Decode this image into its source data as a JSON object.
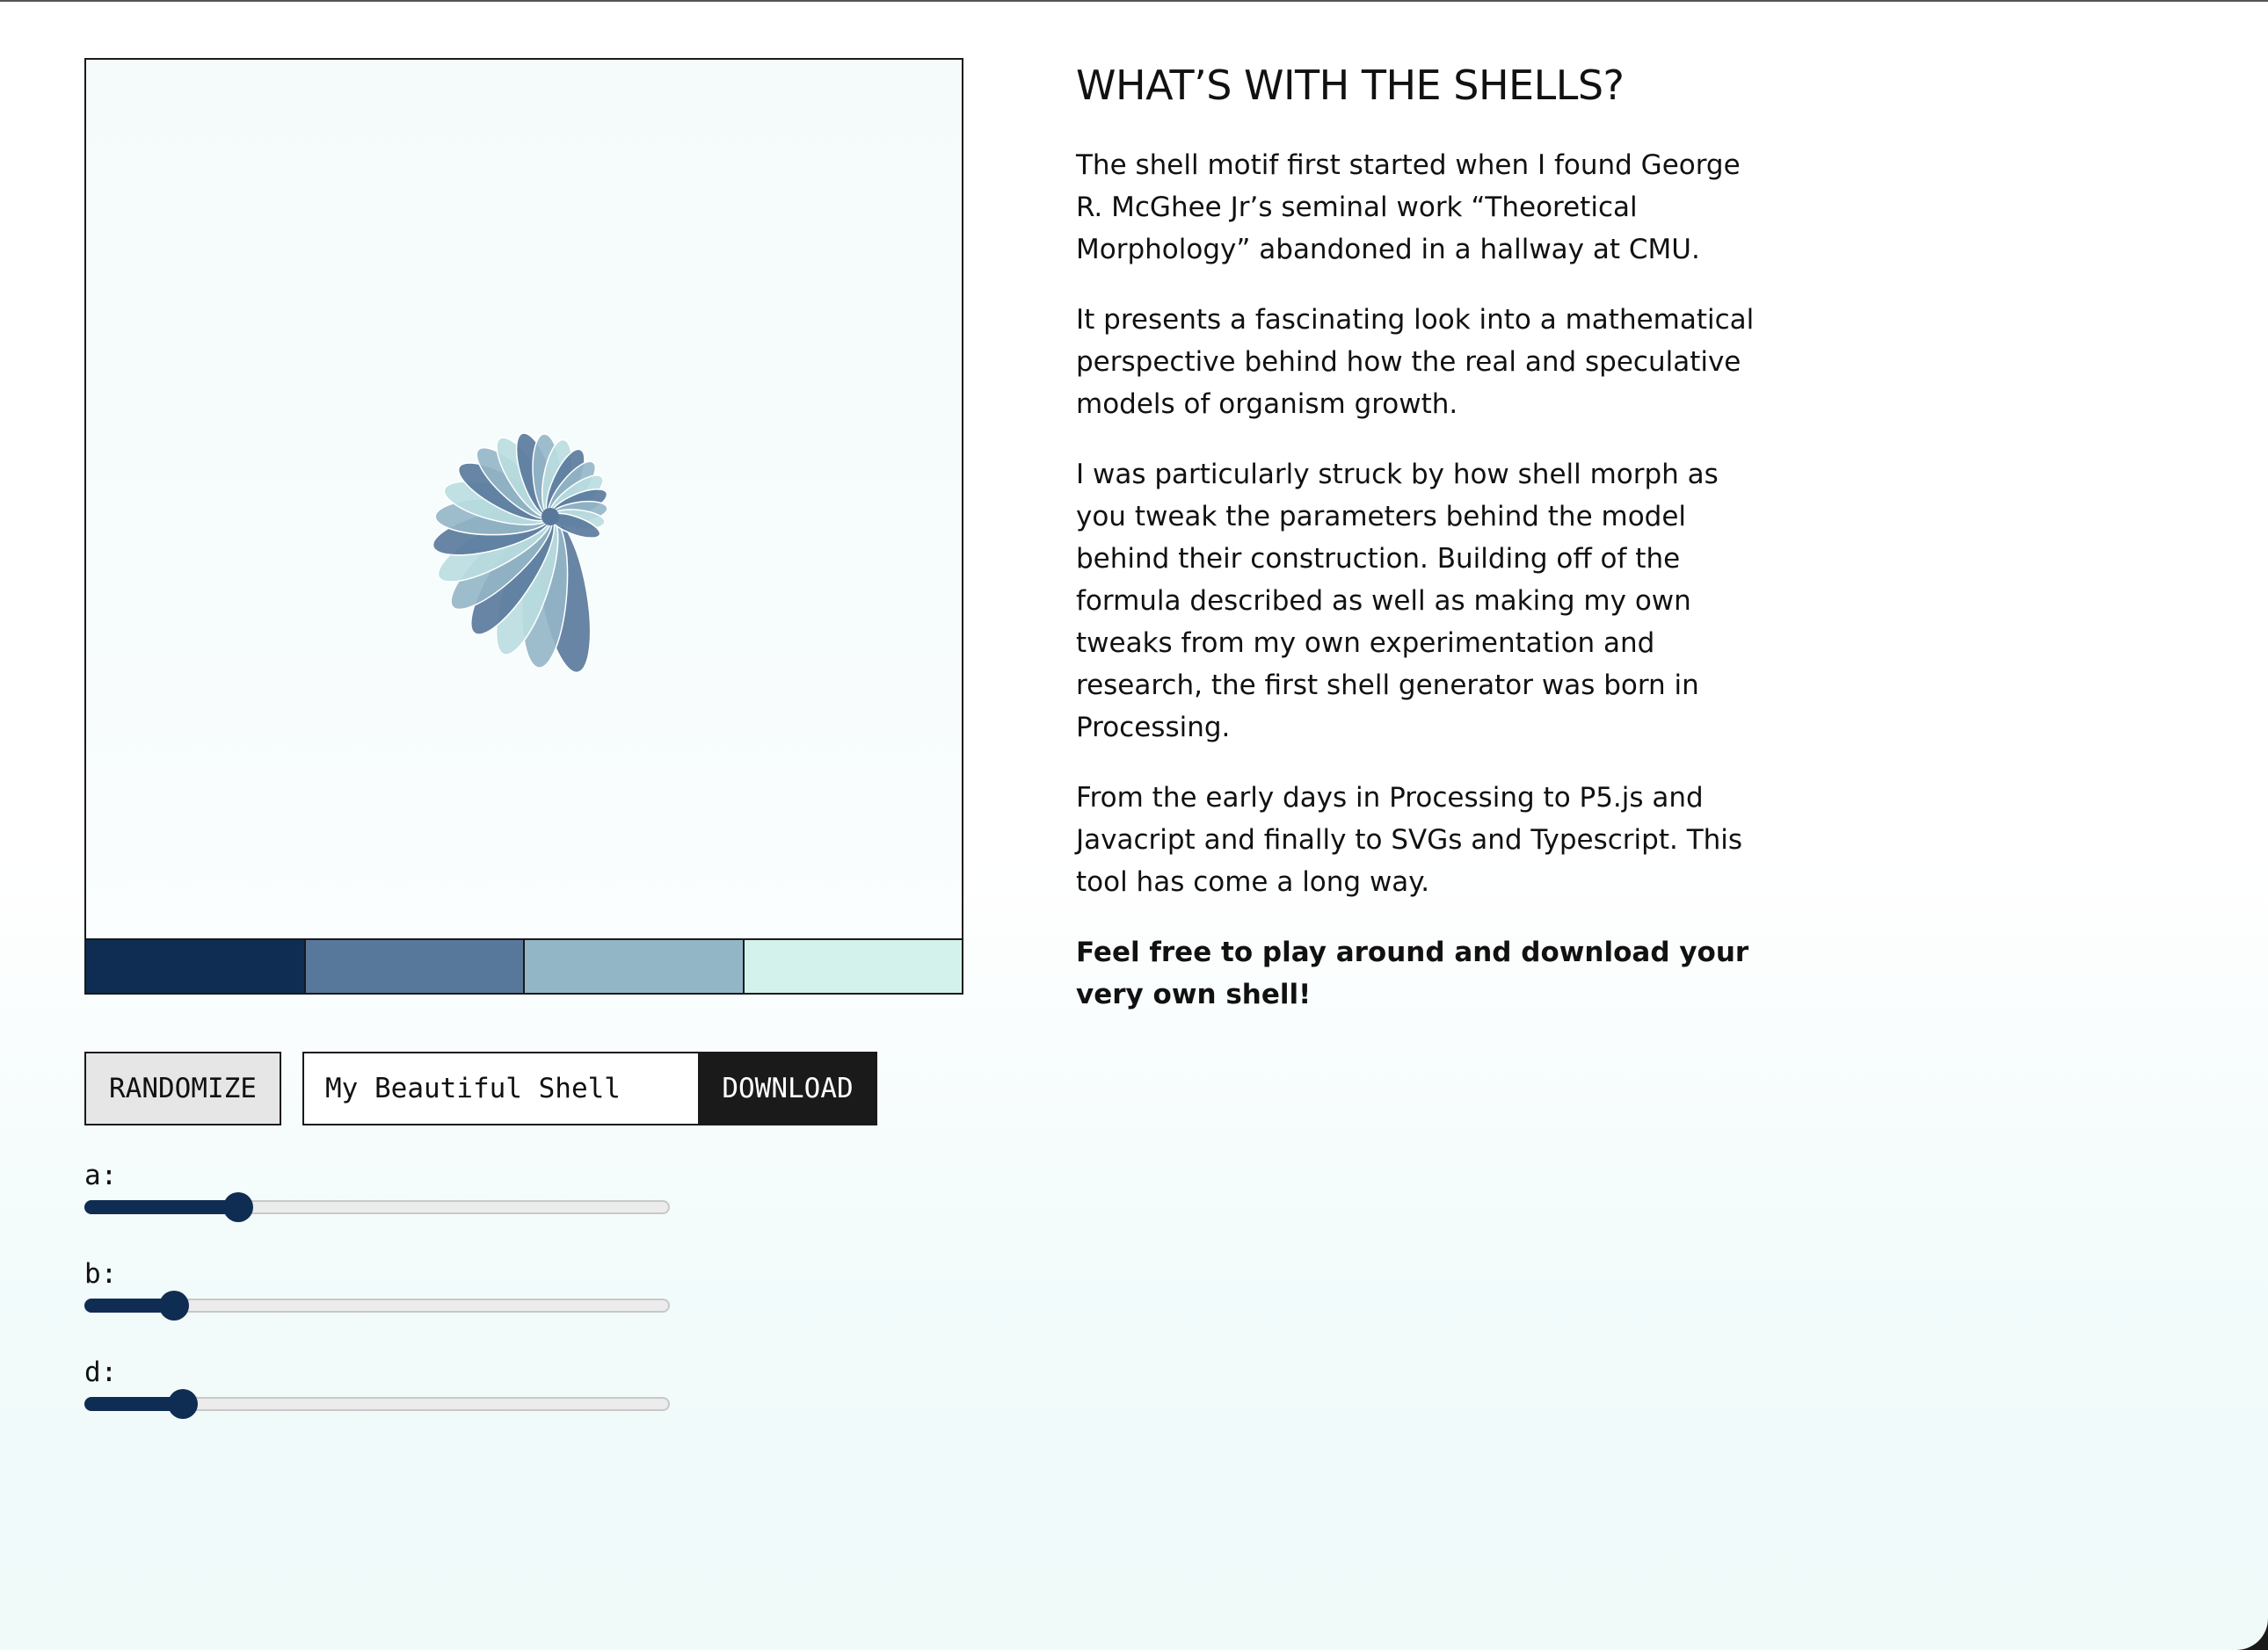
{
  "article": {
    "heading": "WHAT’S WITH THE SHELLS?",
    "paragraphs": [
      "The shell motif first started when I found George R. McGhee Jr’s seminal work “Theoretical Morphology” abandoned in a hallway at CMU.",
      "It presents a fascinating look into a mathematical perspective behind how the real and speculative models of organism growth.",
      "I was particularly struck by how shell morph as you tweak the parameters behind the model behind their construction. Building off of the formula described as well as making my own tweaks from my own experimentation and research, the first shell generator was born in Processing.",
      "From the early days in Processing to P5.js and Javacript and finally to SVGs and Typescript. This tool has come a long way."
    ],
    "cta": "Feel free to play around and download your very own shell!"
  },
  "palette": [
    "#0f2d52",
    "#58789b",
    "#93b6c7",
    "#d4f2ec"
  ],
  "controls": {
    "randomize_label": "RANDOMIZE",
    "name_value": "My Beautiful Shell",
    "download_label": "DOWNLOAD"
  },
  "sliders": [
    {
      "label": "a:",
      "value": 0.26
    },
    {
      "label": "b:",
      "value": 0.15
    },
    {
      "label": "d:",
      "value": 0.165
    }
  ]
}
